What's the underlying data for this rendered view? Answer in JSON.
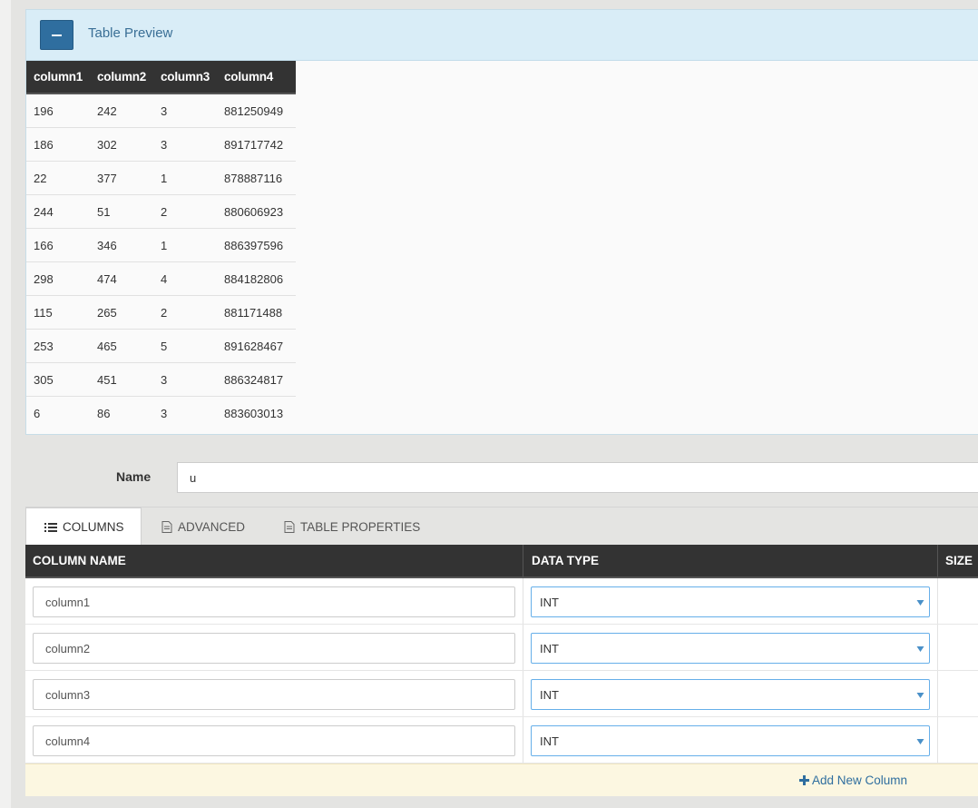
{
  "preview": {
    "title": "Table Preview",
    "headers": [
      "column1",
      "column2",
      "column3",
      "column4"
    ],
    "rows": [
      [
        "196",
        "242",
        "3",
        "881250949"
      ],
      [
        "186",
        "302",
        "3",
        "891717742"
      ],
      [
        "22",
        "377",
        "1",
        "878887116"
      ],
      [
        "244",
        "51",
        "2",
        "880606923"
      ],
      [
        "166",
        "346",
        "1",
        "886397596"
      ],
      [
        "298",
        "474",
        "4",
        "884182806"
      ],
      [
        "115",
        "265",
        "2",
        "881171488"
      ],
      [
        "253",
        "465",
        "5",
        "891628467"
      ],
      [
        "305",
        "451",
        "3",
        "886324817"
      ],
      [
        "6",
        "86",
        "3",
        "883603013"
      ]
    ]
  },
  "name": {
    "label": "Name",
    "value": "u"
  },
  "tabs": [
    {
      "label": "COLUMNS",
      "icon": "list-icon",
      "active": true
    },
    {
      "label": "ADVANCED",
      "icon": "document-icon",
      "active": false
    },
    {
      "label": "TABLE PROPERTIES",
      "icon": "document-icon",
      "active": false
    }
  ],
  "columns_table": {
    "headers": {
      "name": "COLUMN NAME",
      "type": "DATA TYPE",
      "size": "SIZE"
    },
    "rows": [
      {
        "name": "column1",
        "type": "INT"
      },
      {
        "name": "column2",
        "type": "INT"
      },
      {
        "name": "column3",
        "type": "INT"
      },
      {
        "name": "column4",
        "type": "INT"
      }
    ],
    "add_label": "Add New Column"
  },
  "colors": {
    "accent": "#2f6e9f",
    "panel_header": "#d9edf7",
    "table_header": "#333333",
    "add_row_bg": "#fcf7e1",
    "select_border": "#66afe9"
  }
}
